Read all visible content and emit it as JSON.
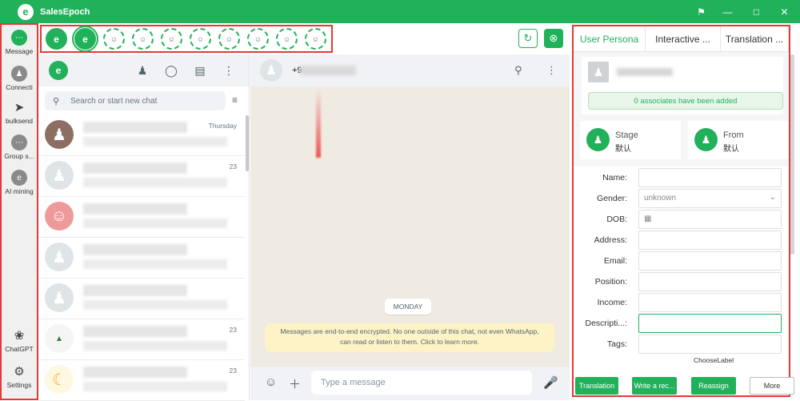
{
  "titlebar": {
    "app_name": "SalesEpoch",
    "logo_letter": "e",
    "controls": [
      "bell-icon",
      "minimize-icon",
      "maximize-icon",
      "close-icon"
    ]
  },
  "rail": {
    "items": [
      {
        "label": "Message",
        "icon": "message-icon"
      },
      {
        "label": "Connecti",
        "icon": "contacts-icon"
      },
      {
        "label": "bulksend",
        "icon": "send-icon"
      },
      {
        "label": "Group s...",
        "icon": "group-icon"
      },
      {
        "label": "AI mining",
        "icon": "ai-mining-icon"
      },
      {
        "label": "ChatGPT",
        "icon": "chatgpt-icon"
      },
      {
        "label": "Settings",
        "icon": "settings-icon"
      }
    ]
  },
  "accounts": {
    "count": 10,
    "active_logo": "e"
  },
  "chat_list": {
    "search_placeholder": "Search or start new chat",
    "rows": [
      {
        "time": "Thursday"
      },
      {
        "time": "23"
      },
      {
        "time": ""
      },
      {
        "time": ""
      },
      {
        "time": ""
      },
      {
        "time": "23"
      },
      {
        "time": "23"
      }
    ]
  },
  "conversation": {
    "contact_prefix": "+9",
    "day": "MONDAY",
    "e2e_notice": "Messages are end-to-end encrypted. No one outside of this chat, not even WhatsApp, can read or listen to them. Click to learn more.",
    "composer_placeholder": "Type a message"
  },
  "right_panel": {
    "tabs": [
      "User Persona",
      "Interactive ...",
      "Translation ..."
    ],
    "associates": "0 associates have been added",
    "stage_label": "Stage",
    "stage_value": "默认",
    "from_label": "From",
    "from_value": "默认",
    "fields": [
      {
        "label": "Name:",
        "value": ""
      },
      {
        "label": "Gender:",
        "value": "unknown"
      },
      {
        "label": "DOB:",
        "value": ""
      },
      {
        "label": "Address:",
        "value": ""
      },
      {
        "label": "Email:",
        "value": ""
      },
      {
        "label": "Position:",
        "value": ""
      },
      {
        "label": "Income:",
        "value": ""
      },
      {
        "label": "Descripti...:",
        "value": ""
      },
      {
        "label": "Tags:",
        "value": ""
      }
    ],
    "choose_label": "ChooseLabel",
    "actions": [
      "Translation",
      "Write a rec...",
      "Reassign",
      "More"
    ]
  },
  "colors": {
    "brand": "#21b15b",
    "highlight": "#e53935"
  }
}
